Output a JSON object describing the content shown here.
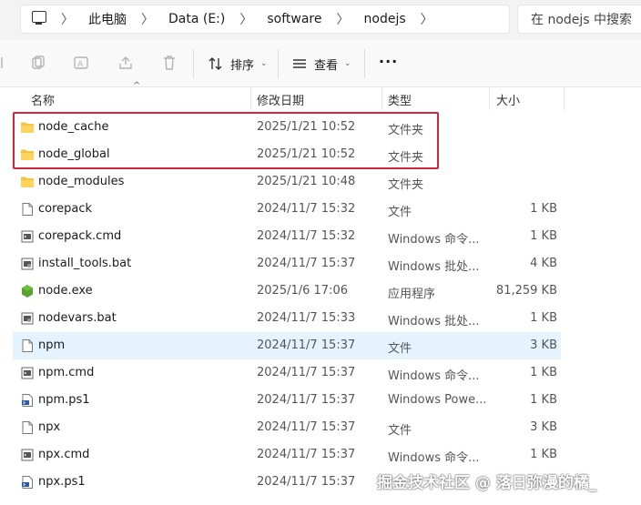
{
  "address": {
    "crumbs": [
      "此电脑",
      "Data (E:)",
      "software",
      "nodejs"
    ],
    "search_placeholder": "在 nodejs 中搜索"
  },
  "toolbar": {
    "sort_label": "排序",
    "view_label": "查看",
    "more_label": "···"
  },
  "columns": {
    "name": "名称",
    "date": "修改日期",
    "type": "类型",
    "size": "大小"
  },
  "files": [
    {
      "name": "node_cache",
      "date": "2025/1/21 10:52",
      "type": "文件夹",
      "size": "",
      "icon": "folder-icon"
    },
    {
      "name": "node_global",
      "date": "2025/1/21 10:52",
      "type": "文件夹",
      "size": "",
      "icon": "folder-icon"
    },
    {
      "name": "node_modules",
      "date": "2025/1/21 10:48",
      "type": "文件夹",
      "size": "",
      "icon": "folder-icon"
    },
    {
      "name": "corepack",
      "date": "2024/11/7 15:32",
      "type": "文件",
      "size": "1 KB",
      "icon": "file-icon"
    },
    {
      "name": "corepack.cmd",
      "date": "2024/11/7 15:32",
      "type": "Windows 命令...",
      "size": "1 KB",
      "icon": "cmd-file-icon"
    },
    {
      "name": "install_tools.bat",
      "date": "2024/11/7 15:37",
      "type": "Windows 批处...",
      "size": "4 KB",
      "icon": "bat-file-icon"
    },
    {
      "name": "node.exe",
      "date": "2025/1/6 17:06",
      "type": "应用程序",
      "size": "81,259 KB",
      "icon": "nodejs-exe-icon"
    },
    {
      "name": "nodevars.bat",
      "date": "2024/11/7 15:33",
      "type": "Windows 批处...",
      "size": "1 KB",
      "icon": "bat-file-icon"
    },
    {
      "name": "npm",
      "date": "2024/11/7 15:37",
      "type": "文件",
      "size": "3 KB",
      "icon": "file-icon"
    },
    {
      "name": "npm.cmd",
      "date": "2024/11/7 15:37",
      "type": "Windows 命令...",
      "size": "1 KB",
      "icon": "cmd-file-icon"
    },
    {
      "name": "npm.ps1",
      "date": "2024/11/7 15:37",
      "type": "Windows Powe...",
      "size": "1 KB",
      "icon": "ps1-file-icon"
    },
    {
      "name": "npx",
      "date": "2024/11/7 15:37",
      "type": "文件",
      "size": "3 KB",
      "icon": "file-icon"
    },
    {
      "name": "npx.cmd",
      "date": "2024/11/7 15:37",
      "type": "Windows 命令...",
      "size": "1 KB",
      "icon": "cmd-file-icon"
    },
    {
      "name": "npx.ps1",
      "date": "2024/11/7 15:37",
      "type": "",
      "size": "",
      "icon": "ps1-file-icon"
    }
  ],
  "hover_row": "npm",
  "highlight_color": "#d0263a",
  "watermark": "掘金技术社区 @ 落日弥漫的橘_"
}
